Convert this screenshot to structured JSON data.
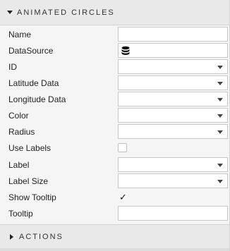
{
  "section": {
    "title": "ANIMATED CIRCLES"
  },
  "fields": [
    {
      "label": "Name",
      "type": "text",
      "value": ""
    },
    {
      "label": "DataSource",
      "type": "datasource",
      "value": ""
    },
    {
      "label": "ID",
      "type": "select",
      "value": ""
    },
    {
      "label": "Latitude Data",
      "type": "select",
      "value": ""
    },
    {
      "label": "Longitude Data",
      "type": "select",
      "value": ""
    },
    {
      "label": "Color",
      "type": "select",
      "value": ""
    },
    {
      "label": "Radius",
      "type": "select",
      "value": ""
    },
    {
      "label": "Use Labels",
      "type": "checkbox",
      "checked": false
    },
    {
      "label": "Label",
      "type": "select",
      "value": ""
    },
    {
      "label": "Label Size",
      "type": "select",
      "value": ""
    },
    {
      "label": "Show Tooltip",
      "type": "checkbox",
      "checked": true
    },
    {
      "label": "Tooltip",
      "type": "text",
      "value": ""
    }
  ],
  "icons": {
    "datasource": "database-icon",
    "checkmark": "✓"
  },
  "actions": {
    "title": "ACTIONS"
  }
}
